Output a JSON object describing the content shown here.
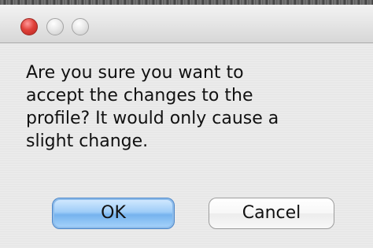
{
  "window": {
    "controls": [
      {
        "icon": "close-icon",
        "color": "#e0413a"
      },
      {
        "icon": "minimize-icon",
        "color": "#d9d9d9"
      },
      {
        "icon": "zoom-icon",
        "color": "#d9d9d9"
      }
    ]
  },
  "dialog": {
    "message_lines": [
      "Are you sure you want to",
      "accept the changes to the",
      "profile?  It would only cause a",
      "slight change."
    ],
    "buttons": {
      "ok_label": "OK",
      "cancel_label": "Cancel"
    }
  },
  "colors": {
    "default_button": "#9fcdf8",
    "close_button": "#e0413a"
  }
}
